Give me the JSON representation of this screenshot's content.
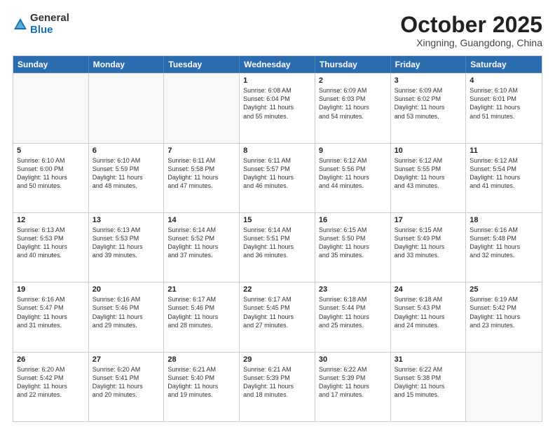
{
  "header": {
    "logo_general": "General",
    "logo_blue": "Blue",
    "month_title": "October 2025",
    "location": "Xingning, Guangdong, China"
  },
  "weekdays": [
    "Sunday",
    "Monday",
    "Tuesday",
    "Wednesday",
    "Thursday",
    "Friday",
    "Saturday"
  ],
  "rows": [
    [
      {
        "day": "",
        "text": ""
      },
      {
        "day": "",
        "text": ""
      },
      {
        "day": "",
        "text": ""
      },
      {
        "day": "1",
        "text": "Sunrise: 6:08 AM\nSunset: 6:04 PM\nDaylight: 11 hours\nand 55 minutes."
      },
      {
        "day": "2",
        "text": "Sunrise: 6:09 AM\nSunset: 6:03 PM\nDaylight: 11 hours\nand 54 minutes."
      },
      {
        "day": "3",
        "text": "Sunrise: 6:09 AM\nSunset: 6:02 PM\nDaylight: 11 hours\nand 53 minutes."
      },
      {
        "day": "4",
        "text": "Sunrise: 6:10 AM\nSunset: 6:01 PM\nDaylight: 11 hours\nand 51 minutes."
      }
    ],
    [
      {
        "day": "5",
        "text": "Sunrise: 6:10 AM\nSunset: 6:00 PM\nDaylight: 11 hours\nand 50 minutes."
      },
      {
        "day": "6",
        "text": "Sunrise: 6:10 AM\nSunset: 5:59 PM\nDaylight: 11 hours\nand 48 minutes."
      },
      {
        "day": "7",
        "text": "Sunrise: 6:11 AM\nSunset: 5:58 PM\nDaylight: 11 hours\nand 47 minutes."
      },
      {
        "day": "8",
        "text": "Sunrise: 6:11 AM\nSunset: 5:57 PM\nDaylight: 11 hours\nand 46 minutes."
      },
      {
        "day": "9",
        "text": "Sunrise: 6:12 AM\nSunset: 5:56 PM\nDaylight: 11 hours\nand 44 minutes."
      },
      {
        "day": "10",
        "text": "Sunrise: 6:12 AM\nSunset: 5:55 PM\nDaylight: 11 hours\nand 43 minutes."
      },
      {
        "day": "11",
        "text": "Sunrise: 6:12 AM\nSunset: 5:54 PM\nDaylight: 11 hours\nand 41 minutes."
      }
    ],
    [
      {
        "day": "12",
        "text": "Sunrise: 6:13 AM\nSunset: 5:53 PM\nDaylight: 11 hours\nand 40 minutes."
      },
      {
        "day": "13",
        "text": "Sunrise: 6:13 AM\nSunset: 5:53 PM\nDaylight: 11 hours\nand 39 minutes."
      },
      {
        "day": "14",
        "text": "Sunrise: 6:14 AM\nSunset: 5:52 PM\nDaylight: 11 hours\nand 37 minutes."
      },
      {
        "day": "15",
        "text": "Sunrise: 6:14 AM\nSunset: 5:51 PM\nDaylight: 11 hours\nand 36 minutes."
      },
      {
        "day": "16",
        "text": "Sunrise: 6:15 AM\nSunset: 5:50 PM\nDaylight: 11 hours\nand 35 minutes."
      },
      {
        "day": "17",
        "text": "Sunrise: 6:15 AM\nSunset: 5:49 PM\nDaylight: 11 hours\nand 33 minutes."
      },
      {
        "day": "18",
        "text": "Sunrise: 6:16 AM\nSunset: 5:48 PM\nDaylight: 11 hours\nand 32 minutes."
      }
    ],
    [
      {
        "day": "19",
        "text": "Sunrise: 6:16 AM\nSunset: 5:47 PM\nDaylight: 11 hours\nand 31 minutes."
      },
      {
        "day": "20",
        "text": "Sunrise: 6:16 AM\nSunset: 5:46 PM\nDaylight: 11 hours\nand 29 minutes."
      },
      {
        "day": "21",
        "text": "Sunrise: 6:17 AM\nSunset: 5:46 PM\nDaylight: 11 hours\nand 28 minutes."
      },
      {
        "day": "22",
        "text": "Sunrise: 6:17 AM\nSunset: 5:45 PM\nDaylight: 11 hours\nand 27 minutes."
      },
      {
        "day": "23",
        "text": "Sunrise: 6:18 AM\nSunset: 5:44 PM\nDaylight: 11 hours\nand 25 minutes."
      },
      {
        "day": "24",
        "text": "Sunrise: 6:18 AM\nSunset: 5:43 PM\nDaylight: 11 hours\nand 24 minutes."
      },
      {
        "day": "25",
        "text": "Sunrise: 6:19 AM\nSunset: 5:42 PM\nDaylight: 11 hours\nand 23 minutes."
      }
    ],
    [
      {
        "day": "26",
        "text": "Sunrise: 6:20 AM\nSunset: 5:42 PM\nDaylight: 11 hours\nand 22 minutes."
      },
      {
        "day": "27",
        "text": "Sunrise: 6:20 AM\nSunset: 5:41 PM\nDaylight: 11 hours\nand 20 minutes."
      },
      {
        "day": "28",
        "text": "Sunrise: 6:21 AM\nSunset: 5:40 PM\nDaylight: 11 hours\nand 19 minutes."
      },
      {
        "day": "29",
        "text": "Sunrise: 6:21 AM\nSunset: 5:39 PM\nDaylight: 11 hours\nand 18 minutes."
      },
      {
        "day": "30",
        "text": "Sunrise: 6:22 AM\nSunset: 5:39 PM\nDaylight: 11 hours\nand 17 minutes."
      },
      {
        "day": "31",
        "text": "Sunrise: 6:22 AM\nSunset: 5:38 PM\nDaylight: 11 hours\nand 15 minutes."
      },
      {
        "day": "",
        "text": ""
      }
    ]
  ]
}
